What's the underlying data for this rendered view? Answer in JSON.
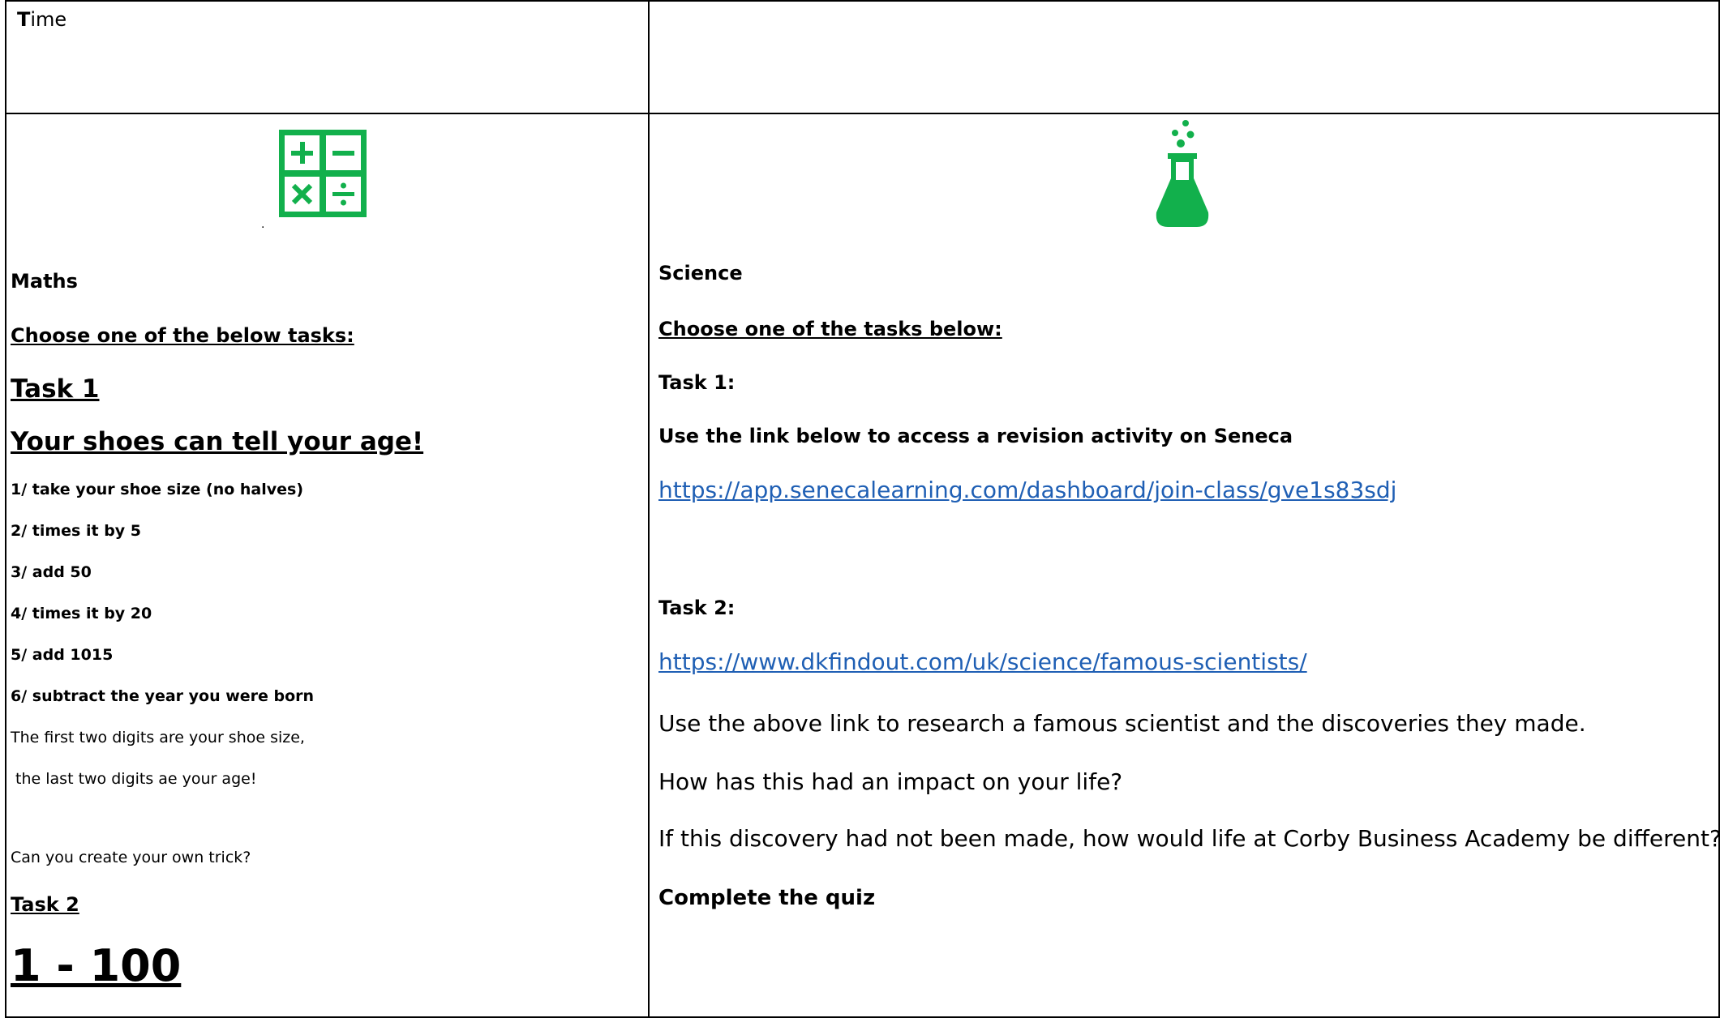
{
  "header": {
    "time_first": "T",
    "time_rest": "ime"
  },
  "maths": {
    "icon": "calculator-operations-icon",
    "icon_color": "#12b04c",
    "dot": ".",
    "title": "Maths",
    "choose": "Choose one of the below tasks:",
    "task1": "Task 1",
    "task1_title": "Your shoes can tell your age!",
    "steps": [
      "1/ take your shoe size (no halves)",
      "2/ times it by 5",
      "3/ add 50",
      "4/ times it by 20",
      "5/ add 1015",
      "6/ subtract the year you were born"
    ],
    "line1": "The first two digits are your shoe size,",
    "line2": " the last two digits ae your age!",
    "question": "Can you create your own trick?",
    "task2": "Task 2",
    "task2_title": "1 - 100"
  },
  "science": {
    "icon": "flask-icon",
    "icon_color": "#12b04c",
    "title": "Science",
    "choose": "Choose one of the tasks below:",
    "task1": "Task 1:",
    "task1_instruction": "Use the link below to access a revision activity on Seneca",
    "task1_link": "https://app.senecalearning.com/dashboard/join-class/gve1s83sdj",
    "task2": "Task 2:",
    "task2_link": "https://www.dkfindout.com/uk/science/famous-scientists/",
    "research": "Use the above link to research a famous scientist and the discoveries they made.",
    "impact": "How has this had an impact on your life?",
    "different": "If this discovery had not been made, how would life at Corby Business Academy be different?",
    "quiz": "Complete the quiz"
  }
}
